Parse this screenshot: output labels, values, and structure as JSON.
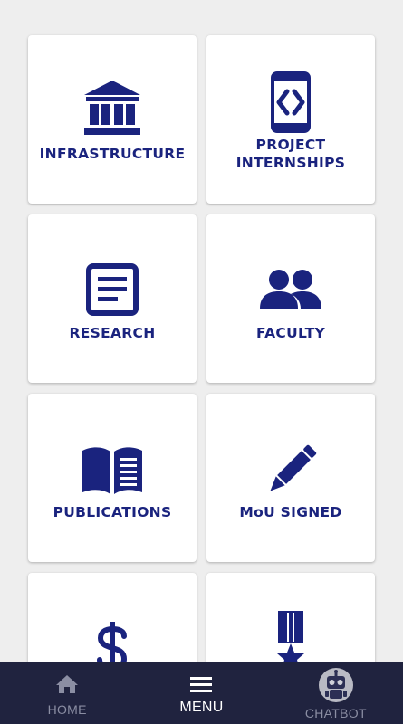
{
  "tiles": [
    {
      "label": "INFRASTRUCTURE",
      "icon": "institution-icon"
    },
    {
      "label_line1": "PROJECT",
      "label_line2": "INTERNSHIPS",
      "icon": "code-device-icon"
    },
    {
      "label": "RESEARCH",
      "icon": "document-icon"
    },
    {
      "label": "FACULTY",
      "icon": "people-icon"
    },
    {
      "label": "PUBLICATIONS",
      "icon": "open-book-icon"
    },
    {
      "label": "MoU SIGNED",
      "icon": "pencil-icon"
    },
    {
      "label": "",
      "icon": "dollar-icon"
    },
    {
      "label": "",
      "icon": "medal-icon"
    }
  ],
  "nav": {
    "home": "HOME",
    "menu": "MENU",
    "chatbot": "CHATBOT"
  },
  "colors": {
    "accent": "#1a237e",
    "background": "#eeeeee",
    "nav_background": "#20233f",
    "nav_inactive": "#8b8ea3",
    "nav_active": "#ffffff"
  }
}
